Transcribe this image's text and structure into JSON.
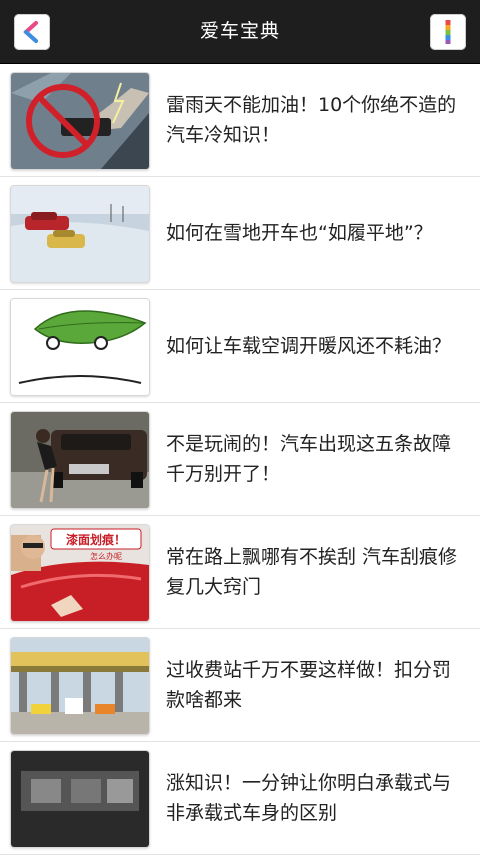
{
  "header": {
    "title": "爱车宝典",
    "back_icon": "back-chevron-icon",
    "menu_icon": "menu-icon"
  },
  "articles": [
    {
      "title": "雷雨天不能加油！10个你绝不造的汽车冷知识！"
    },
    {
      "title": "如何在雪地开车也“如履平地”？"
    },
    {
      "title": "如何让车载空调开暖风还不耗油？"
    },
    {
      "title": "不是玩闹的！汽车出现这五条故障千万别开了！"
    },
    {
      "title": "常在路上飘哪有不挨刮 汽车刮痕修复几大窍门"
    },
    {
      "title": "过收费站千万不要这样做！扣分罚款啥都来"
    },
    {
      "title": "涨知识！一分钟让你明白承载式与非承载式车身的区别"
    }
  ],
  "thumb_text": {
    "scratch_sign": "漆面划痕！",
    "scratch_sub": "怎么办呢"
  },
  "colors": {
    "header_bg": "#1e1e1e",
    "title_text": "#ffffff",
    "item_text": "#222222",
    "divider": "#e2e2e2"
  }
}
